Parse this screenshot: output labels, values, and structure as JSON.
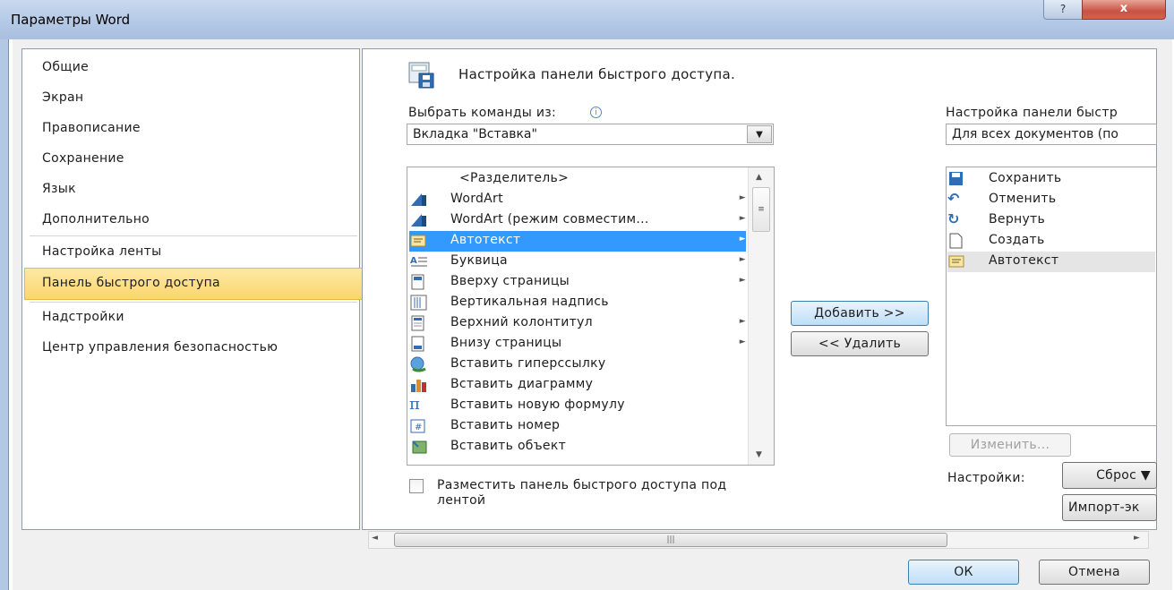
{
  "window": {
    "title": "Параметры Word",
    "help_label": "?",
    "close_label": "x"
  },
  "nav": {
    "items": [
      {
        "label": "Общие"
      },
      {
        "label": "Экран"
      },
      {
        "label": "Правописание"
      },
      {
        "label": "Сохранение"
      },
      {
        "label": "Язык"
      },
      {
        "label": "Дополнительно"
      },
      {
        "label": "Настройка ленты"
      },
      {
        "label": "Панель быстрого доступа",
        "selected": true
      },
      {
        "label": "Надстройки"
      },
      {
        "label": "Центр управления безопасностью"
      }
    ]
  },
  "main": {
    "heading": "Настройка панели быстрого доступа.",
    "choose_label": "Выбрать команды из:",
    "choose_value": "Вкладка \"Вставка\"",
    "customize_label": "Настройка панели быстр",
    "customize_value": "Для всех документов (по",
    "commands": [
      {
        "label": "<Разделитель>",
        "icon": "none",
        "submenu": false
      },
      {
        "label": "WordArt",
        "icon": "wordart-icon",
        "submenu": true
      },
      {
        "label": "WordArt (режим совместим...",
        "icon": "wordart-icon",
        "submenu": true
      },
      {
        "label": "Автотекст",
        "icon": "autotext-icon",
        "submenu": true,
        "selected": true
      },
      {
        "label": "Буквица",
        "icon": "dropcap-icon",
        "submenu": true
      },
      {
        "label": "Вверху страницы",
        "icon": "page-top-icon",
        "submenu": true
      },
      {
        "label": "Вертикальная надпись",
        "icon": "vertical-text-icon",
        "submenu": false
      },
      {
        "label": "Верхний колонтитул",
        "icon": "header-icon",
        "submenu": true
      },
      {
        "label": "Внизу страницы",
        "icon": "page-bottom-icon",
        "submenu": true
      },
      {
        "label": "Вставить гиперссылку",
        "icon": "hyperlink-icon",
        "submenu": false
      },
      {
        "label": "Вставить диаграмму",
        "icon": "chart-icon",
        "submenu": false
      },
      {
        "label": "Вставить новую формулу",
        "icon": "pi-icon",
        "submenu": false
      },
      {
        "label": "Вставить номер",
        "icon": "number-icon",
        "submenu": false
      },
      {
        "label": "Вставить объект",
        "icon": "object-icon",
        "submenu": false
      }
    ],
    "toolbar_items": [
      {
        "label": "Сохранить",
        "icon": "save-icon"
      },
      {
        "label": "Отменить",
        "icon": "undo-icon"
      },
      {
        "label": "Вернуть",
        "icon": "redo-icon"
      },
      {
        "label": "Создать",
        "icon": "new-doc-icon"
      },
      {
        "label": "Автотекст",
        "icon": "autotext-icon",
        "selected": true
      }
    ],
    "add_button": "Добавить >>",
    "remove_button": "<< Удалить",
    "modify_button": "Изменить...",
    "settings_label": "Настройки:",
    "reset_button": "Сброс ▼",
    "import_button": "Импорт-эк",
    "below_ribbon_checkbox": "Разместить панель быстрого доступа под лентой",
    "below_ribbon_checked": false
  },
  "footer": {
    "ok": "ОК",
    "cancel": "Отмена"
  },
  "colors": {
    "selection_blue": "#3399ff",
    "nav_selected": "#fbd56d",
    "title_bar": "#b3c8e5"
  }
}
